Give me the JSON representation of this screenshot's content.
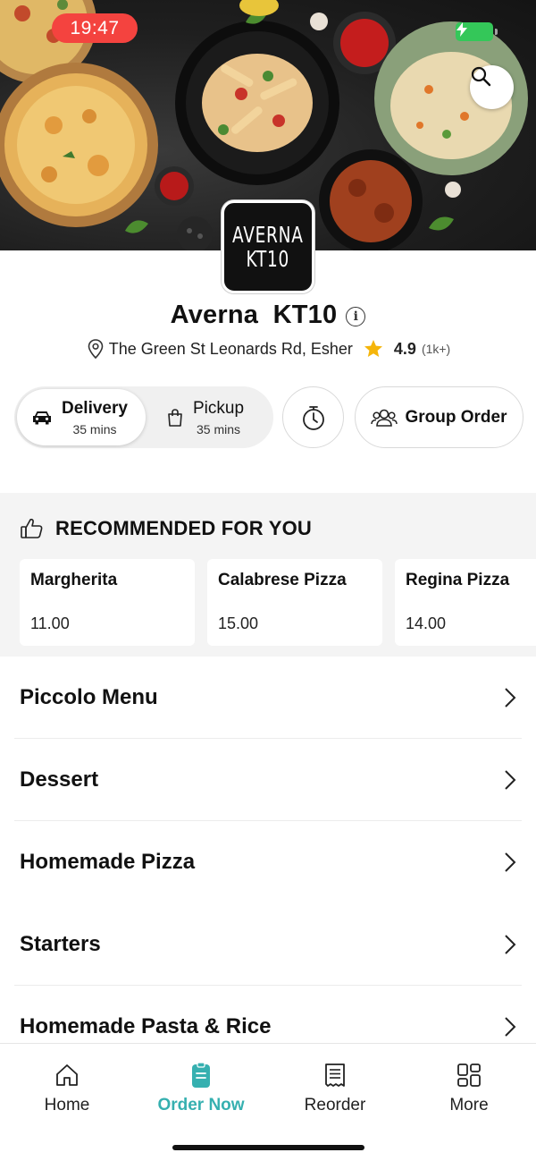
{
  "status_bar": {
    "time": "19:47"
  },
  "hero": {
    "search_icon": "search-icon"
  },
  "restaurant": {
    "logo_line1": "AVERNA",
    "logo_line2": "KT10",
    "name": "Averna  KT10",
    "address": "The Green St Leonards Rd, Esher",
    "rating": "4.9",
    "rating_count": "(1k+)"
  },
  "order_mode": {
    "delivery": {
      "label": "Delivery",
      "time": "35 mins",
      "selected": true
    },
    "pickup": {
      "label": "Pickup",
      "time": "35 mins",
      "selected": false
    },
    "group_order_label": "Group Order"
  },
  "recommended": {
    "title": "RECOMMENDED FOR YOU",
    "items": [
      {
        "name": "Margherita",
        "price": "11.00"
      },
      {
        "name": "Calabrese Pizza",
        "price": "15.00"
      },
      {
        "name": "Regina Pizza",
        "price": "14.00"
      }
    ]
  },
  "categories": [
    "Piccolo Menu",
    "Dessert",
    "Homemade Pizza",
    "Starters",
    "Homemade Pasta & Rice"
  ],
  "bottom_nav": {
    "items": [
      {
        "label": "Home",
        "icon": "home-icon"
      },
      {
        "label": "Order Now",
        "icon": "order-icon",
        "active": true
      },
      {
        "label": "Reorder",
        "icon": "receipt-icon"
      },
      {
        "label": "More",
        "icon": "grid-icon"
      }
    ]
  },
  "colors": {
    "accent": "#36b0b0",
    "time_pill": "#f4433f",
    "star": "#f5b50a"
  }
}
